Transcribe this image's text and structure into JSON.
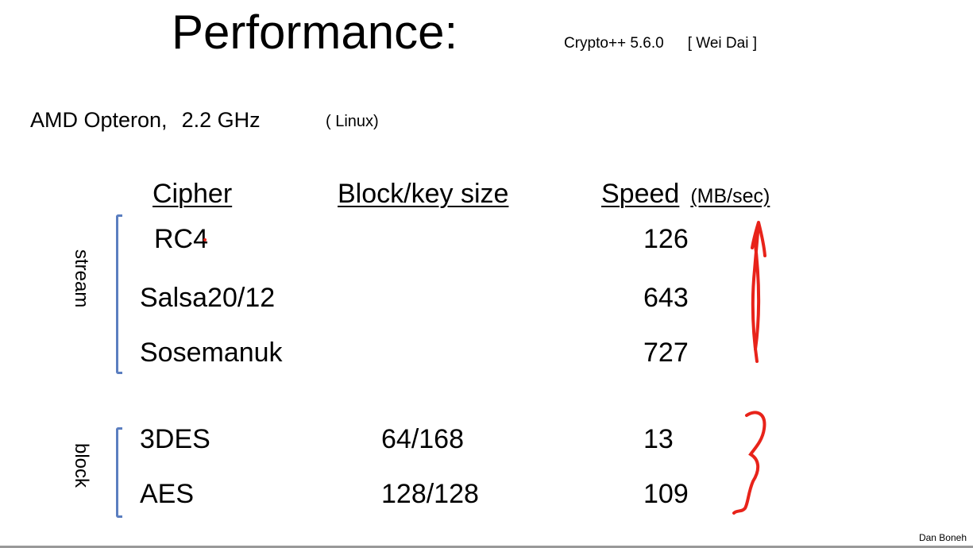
{
  "slide": {
    "title": "Performance:",
    "library": "Crypto++  5.6.0",
    "author_ref": "[ Wei Dai ]",
    "platform": "AMD Opteron,",
    "frequency": "2.2 GHz",
    "os": "( Linux)",
    "footer": "Dan Boneh"
  },
  "table": {
    "headers": {
      "cipher": "Cipher",
      "block_key": "Block/key size",
      "speed": "Speed",
      "speed_unit": "(MB/sec)"
    },
    "groups": [
      {
        "label": "stream",
        "rows": [
          {
            "cipher": "RC4",
            "block_key": "",
            "speed": "126"
          },
          {
            "cipher": "Salsa20/12",
            "block_key": "",
            "speed": "643"
          },
          {
            "cipher": "Sosemanuk",
            "block_key": "",
            "speed": "727"
          }
        ]
      },
      {
        "label": "block",
        "rows": [
          {
            "cipher": "3DES",
            "block_key": "64/168",
            "speed": "13"
          },
          {
            "cipher": "AES",
            "block_key": "128/128",
            "speed": "109"
          }
        ]
      }
    ]
  },
  "colors": {
    "bracket": "#5b7ec0",
    "annotation": "#e8231a"
  }
}
